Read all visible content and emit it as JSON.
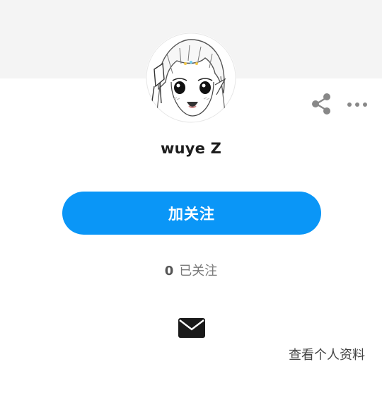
{
  "profile": {
    "username": "wuye Z",
    "avatar_icon": "anime-avatar"
  },
  "header": {
    "share_icon": "share-icon",
    "more_icon": "more-icon",
    "banner_color": "#f4f4f4"
  },
  "actions": {
    "follow_label": "加关注",
    "follow_color": "#0a96f7",
    "mail_icon": "mail-icon"
  },
  "stats": {
    "following_count": "0",
    "following_label": "已关注"
  },
  "footer": {
    "view_profile_label": "查看个人资料"
  }
}
